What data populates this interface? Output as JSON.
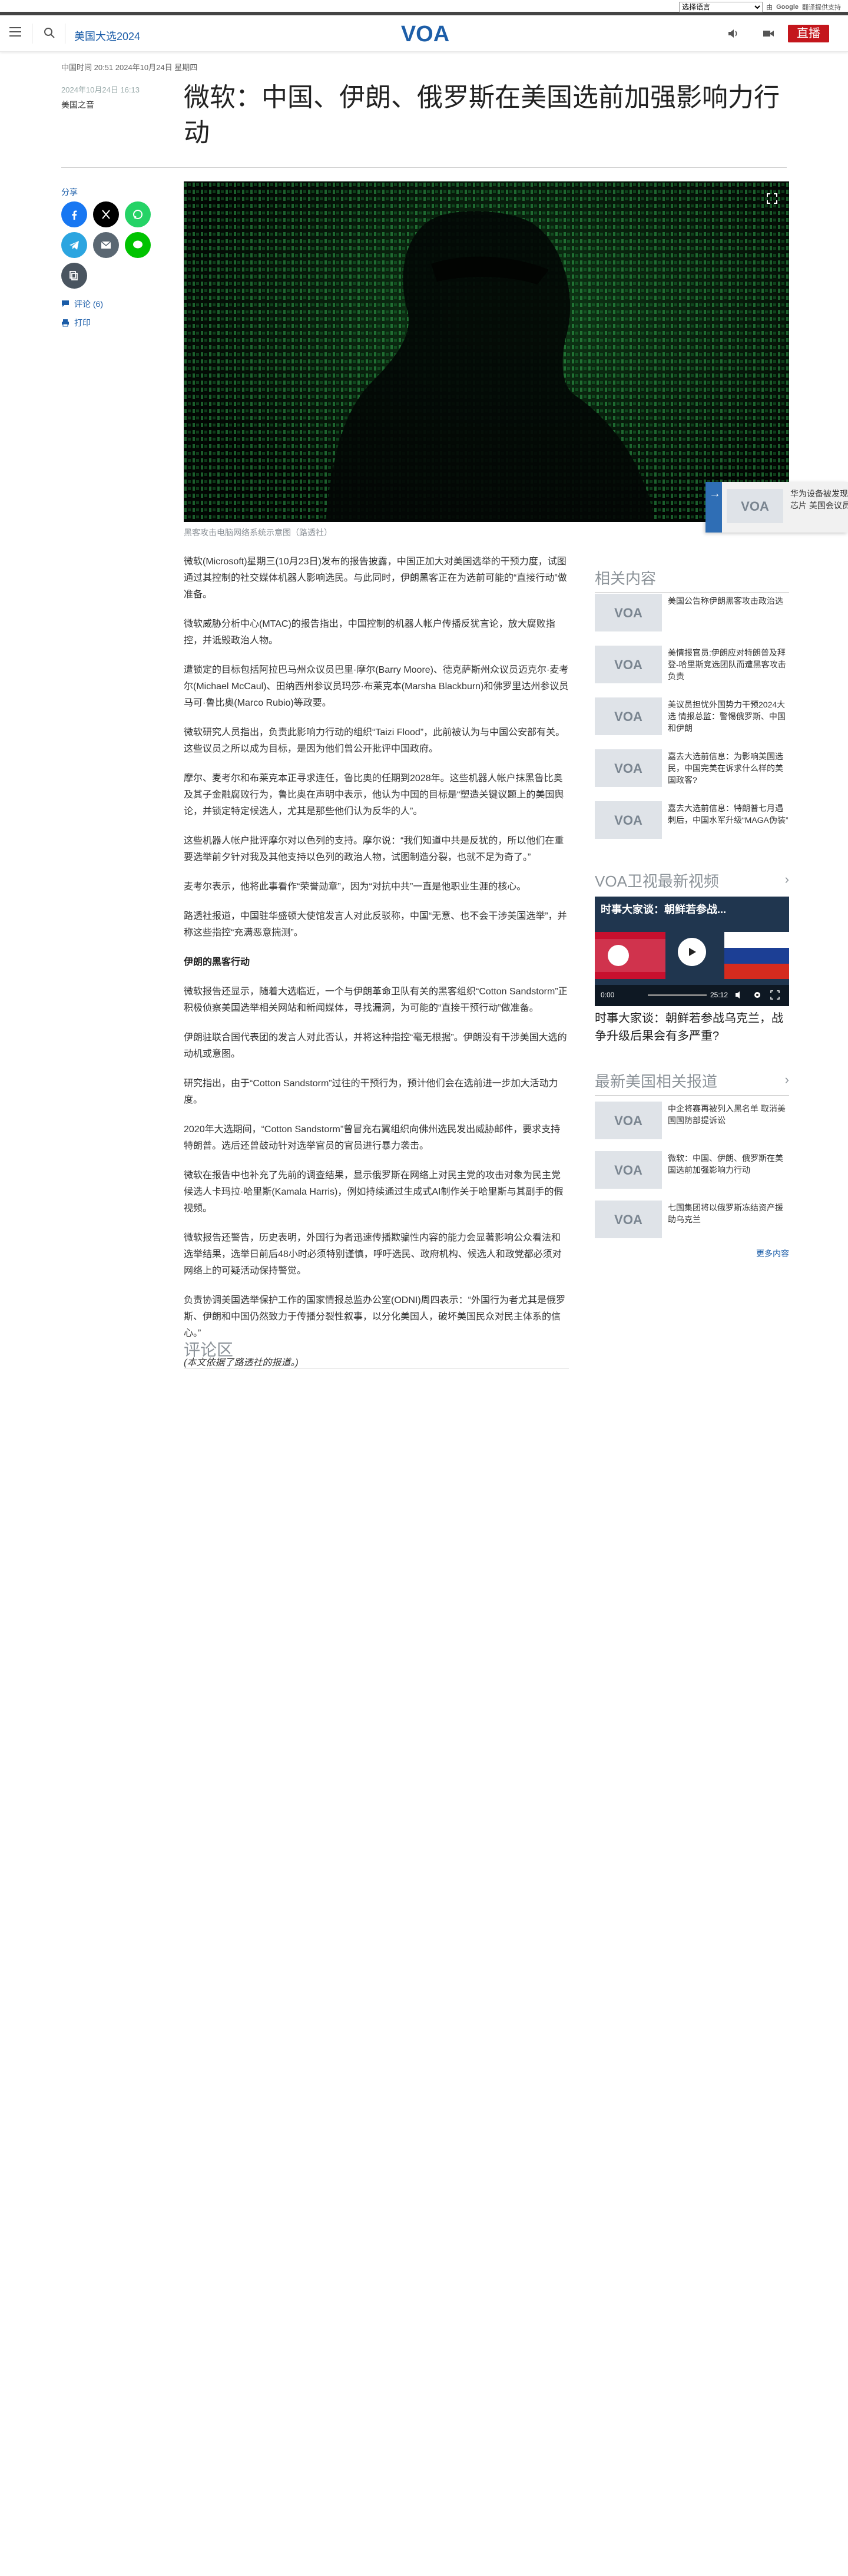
{
  "langbar": {
    "select_value": "选择语言",
    "powered_prefix": "由",
    "google_label": "Google",
    "translate_label": "翻译提供支持"
  },
  "header": {
    "nav_link": "美国大选2024",
    "logo_text": "VOA",
    "live_label": "直播"
  },
  "article": {
    "updated": "中国时间 20:51 2024年10月24日 星期四",
    "published": "2024年10月24日 16:13",
    "author": "美国之音",
    "title": "微软：中国、伊朗、俄罗斯在美国选前加强影响力行动",
    "share_label": "分享",
    "comments_action": "评论 (6)",
    "print_action": "打印",
    "image_caption": "黑客攻击电脑网络系统示意图（路透社）",
    "paragraphs": [
      "微软(Microsoft)星期三(10月23日)发布的报告披露，中国正加大对美国选举的干预力度，试图通过其控制的社交媒体机器人影响选民。与此同时，伊朗黑客正在为选前可能的“直接行动”做准备。",
      "微软威胁分析中心(MTAC)的报告指出，中国控制的机器人帐户传播反犹言论，放大腐败指控，并诋毁政治人物。",
      "遭锁定的目标包括阿拉巴马州众议员巴里·摩尔(Barry Moore)、德克萨斯州众议员迈克尔·麦考尔(Michael McCaul)、田纳西州参议员玛莎·布莱克本(Marsha Blackburn)和佛罗里达州参议员马可·鲁比奥(Marco Rubio)等政要。",
      "微软研究人员指出，负责此影响力行动的组织“Taizi Flood”，此前被认为与中国公安部有关。这些议员之所以成为目标，是因为他们曾公开批评中国政府。",
      "摩尔、麦考尔和布莱克本正寻求连任，鲁比奥的任期到2028年。这些机器人帐户抹黑鲁比奥及其子金融腐败行为，鲁比奥在声明中表示，他认为中国的目标是“塑造关键议题上的美国舆论，并锁定特定候选人，尤其是那些他们认为反华的人”。",
      "这些机器人帐户批评摩尔对以色列的支持。摩尔说：“我们知道中共是反犹的，所以他们在重要选举前夕针对我及其他支持以色列的政治人物，试图制造分裂，也就不足为奇了。”",
      "麦考尔表示，他将此事看作“荣誉勋章”，因为“对抗中共”一直是他职业生涯的核心。",
      "路透社报道，中国驻华盛顿大使馆发言人对此反驳称，中国“无意、也不会干涉美国选举”，并称这些指控“充满恶意揣测”。",
      "微软报告还显示，随着大选临近，一个与伊朗革命卫队有关的黑客组织“Cotton Sandstorm”正积极侦察美国选举相关网站和新闻媒体，寻找漏洞，为可能的“直接干预行动”做准备。",
      "伊朗驻联合国代表团的发言人对此否认，并将这种指控“毫无根据”。伊朗没有干涉美国大选的动机或意图。",
      "研究指出，由于“Cotton Sandstorm”过往的干预行为，预计他们会在选前进一步加大活动力度。",
      "2020年大选期间，“Cotton Sandstorm”曾冒充右翼组织向佛州选民发出威胁邮件，要求支持特朗普。选后还曾鼓动针对选举官员的官员进行暴力袭击。",
      "微软在报告中也补充了先前的调查结果，显示俄罗斯在网络上对民主党的攻击对象为民主党候选人卡玛拉·哈里斯(Kamala Harris)，例如持续通过生成式AI制作关于哈里斯与其副手的假视频。",
      "微软报告还警告，历史表明，外国行为者迅速传播欺骗性内容的能力会显著影响公众看法和选举结果，选举日前后48小时必须特别谨慎，呼吁选民、政府机构、候选人和政党都必须对网络上的可疑活动保持警觉。",
      "负责协调美国选举保护工作的国家情报总监办公室(ODNI)周四表示：“外国行为者尤其是俄罗斯、伊朗和中国仍然致力于传播分裂性叙事，以分化美国人，破坏美国民众对民主体系的信心。”",
      "(本文依据了路透社的报道。)"
    ],
    "subheading": "伊朗的黑客行动",
    "subheading_after_index": 7,
    "comments_title": "评论区"
  },
  "promo": {
    "text_line1": "华为设备被发现",
    "text_line2": "芯片 美国会议员"
  },
  "sidebar": {
    "related_title": "相关内容",
    "related": [
      "美国公告称伊朗黑客攻击政治选",
      "美情报官员:伊朗应对特朗普及拜登-哈里斯竞选团队而遭黑客攻击负责",
      "美议员担忧外国势力干预2024大选 情报总监：警惕俄罗斯、中国和伊朗",
      "嘉去大选前信息：为影响美国选民，中国完美在诉求什么样的美国政客?",
      "嘉去大选前信息：特朗普七月遇刺后，中国水军升级“MAGA伪装”"
    ],
    "video_section_title": "VOA卫视最新视频",
    "video": {
      "overlay_title": "时事大家谈：朝鲜若参战...",
      "time_current": "0:00",
      "time_total": "25:12",
      "title": "时事大家谈：朝鲜若参战乌克兰，战争升级后果会有多严重?"
    },
    "latest_title": "最新美国相关报道",
    "latest": [
      "中企将赛再被列入黑名单 取消美国国防部提诉讼",
      "微软：中国、伊朗、俄罗斯在美国选前加强影响力行动",
      "七国集团将以俄罗斯冻结资产援助乌克兰"
    ],
    "more_label": "更多内容"
  },
  "colors": {
    "accent_blue": "#1a5ca8",
    "live_red": "#c4161c",
    "facebook": "#1877f2",
    "x": "#000000",
    "whatsapp": "#25d366",
    "telegram": "#2ca5e0",
    "email": "#5a6772",
    "line": "#00c300",
    "copy": "#4a5560"
  },
  "icons": [
    "hamburger-icon",
    "search-icon",
    "audio-icon",
    "video-icon",
    "facebook-icon",
    "x-icon",
    "whatsapp-icon",
    "telegram-icon",
    "email-icon",
    "line-icon",
    "copy-link-icon",
    "comment-icon",
    "print-icon",
    "fullscreen-icon",
    "arrow-right-icon",
    "chevron-right-icon",
    "play-icon"
  ]
}
